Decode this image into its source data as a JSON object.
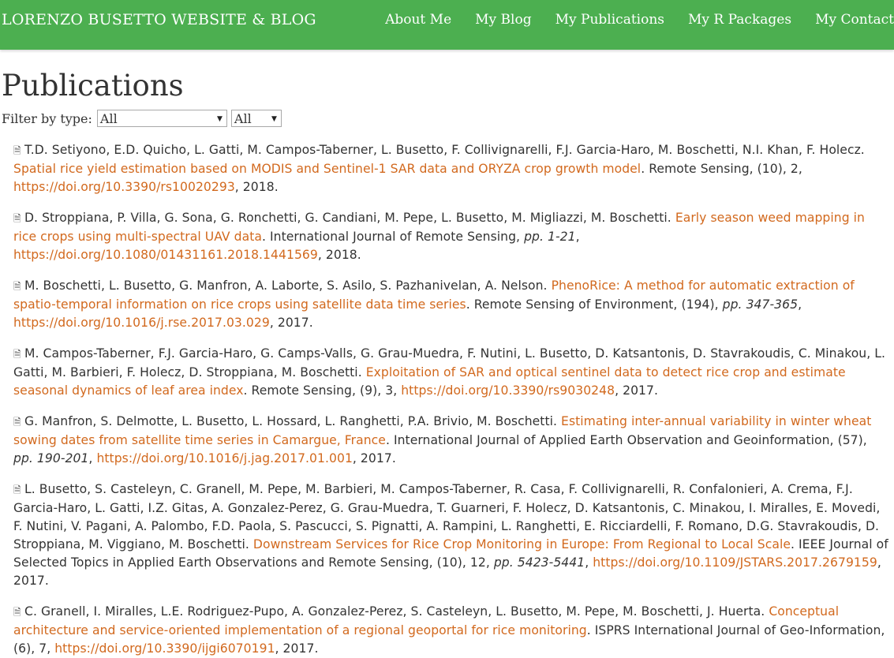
{
  "navbar": {
    "brand": "LORENZO BUSETTO WEBSITE & BLOG",
    "links": [
      "About Me",
      "My Blog",
      "My Publications",
      "My R Packages",
      "My Contact"
    ]
  },
  "page": {
    "title": "Publications",
    "filter_label": "Filter by type:",
    "type_select": "All",
    "year_select": "All"
  },
  "publications": [
    {
      "authors": "T.D. Setiyono, E.D. Quicho, L. Gatti, M. Campos-Taberner, L. Busetto, F. Collivignarelli, F.J. Garcia-Haro, M. Boschetti, N.I. Khan, F. Holecz.",
      "title": "Spatial rice yield estimation based on MODIS and Sentinel-1 SAR data and ORYZA crop growth model",
      "journal": "Remote Sensing, (10), 2,",
      "pages": "",
      "doi": "https://doi.org/10.3390/rs10020293",
      "year": ", 2018."
    },
    {
      "authors": "D. Stroppiana, P. Villa, G. Sona, G. Ronchetti, G. Candiani, M. Pepe, L. Busetto, M. Migliazzi, M. Boschetti.",
      "title": "Early season weed mapping in rice crops using multi-spectral UAV data",
      "journal": "International Journal of Remote Sensing,",
      "pages": "pp. 1-21",
      "doi": "https://doi.org/10.1080/01431161.2018.1441569",
      "year": ", 2018."
    },
    {
      "authors": "M. Boschetti, L. Busetto, G. Manfron, A. Laborte, S. Asilo, S. Pazhanivelan, A. Nelson.",
      "title": "PhenoRice: A method for automatic extraction of spatio-temporal information on rice crops using satellite data time series",
      "journal": "Remote Sensing of Environment, (194),",
      "pages": "pp. 347-365",
      "doi": "https://doi.org/10.1016/j.rse.2017.03.029",
      "year": ", 2017."
    },
    {
      "authors": "M. Campos-Taberner, F.J. Garcia-Haro, G. Camps-Valls, G. Grau-Muedra, F. Nutini, L. Busetto, D. Katsantonis, D. Stavrakoudis, C. Minakou, L. Gatti, M. Barbieri, F. Holecz, D. Stroppiana, M. Boschetti.",
      "title": "Exploitation of SAR and optical sentinel data to detect rice crop and estimate seasonal dynamics of leaf area index",
      "journal": "Remote Sensing, (9), 3,",
      "pages": "",
      "doi": "https://doi.org/10.3390/rs9030248",
      "year": ", 2017."
    },
    {
      "authors": "G. Manfron, S. Delmotte, L. Busetto, L. Hossard, L. Ranghetti, P.A. Brivio, M. Boschetti.",
      "title": "Estimating inter-annual variability in winter wheat sowing dates from satellite time series in Camargue, France",
      "journal": "International Journal of Applied Earth Observation and Geoinformation, (57),",
      "pages": "pp. 190-201",
      "doi": "https://doi.org/10.1016/j.jag.2017.01.001",
      "year": ", 2017."
    },
    {
      "authors": "L. Busetto, S. Casteleyn, C. Granell, M. Pepe, M. Barbieri, M. Campos-Taberner, R. Casa, F. Collivignarelli, R. Confalonieri, A. Crema, F.J. Garcia-Haro, L. Gatti, I.Z. Gitas, A. Gonzalez-Perez, G. Grau-Muedra, T. Guarneri, F. Holecz, D. Katsantonis, C. Minakou, I. Miralles, E. Movedi, F. Nutini, V. Pagani, A. Palombo, F.D. Paola, S. Pascucci, S. Pignatti, A. Rampini, L. Ranghetti, E. Ricciardelli, F. Romano, D.G. Stavrakoudis, D. Stroppiana, M. Viggiano, M. Boschetti.",
      "title": "Downstream Services for Rice Crop Monitoring in Europe: From Regional to Local Scale",
      "journal": "IEEE Journal of Selected Topics in Applied Earth Observations and Remote Sensing, (10), 12,",
      "pages": "pp. 5423-5441",
      "doi": "https://doi.org/10.1109/JSTARS.2017.2679159",
      "year": ", 2017."
    },
    {
      "authors": "C. Granell, I. Miralles, L.E. Rodriguez-Pupo, A. Gonzalez-Perez, S. Casteleyn, L. Busetto, M. Pepe, M. Boschetti, J. Huerta.",
      "title": "Conceptual architecture and service-oriented implementation of a regional geoportal for rice monitoring",
      "journal": "ISPRS International Journal of Geo-Information, (6), 7,",
      "pages": "",
      "doi": "https://doi.org/10.3390/ijgi6070191",
      "year": ", 2017."
    }
  ]
}
